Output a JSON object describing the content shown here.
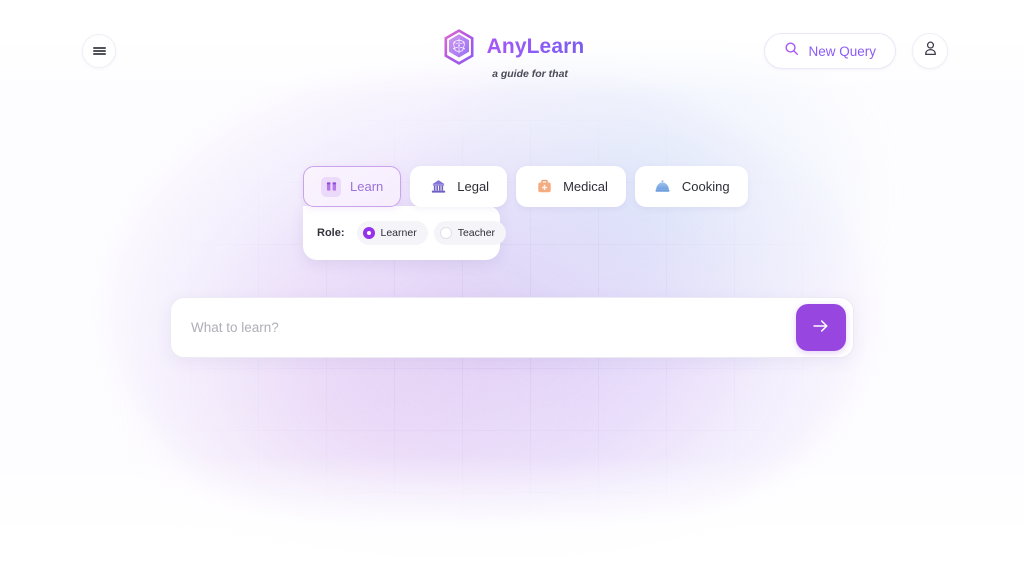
{
  "header": {
    "menu_icon": "hamburger-menu-icon",
    "brand": {
      "name": "AnyLearn",
      "tagline": "a guide for that",
      "logo_icon": "hexagon-brain-logo-icon"
    },
    "new_query": {
      "label": "New Query",
      "icon": "search-icon"
    },
    "account": {
      "icon": "user-avatar-icon"
    }
  },
  "tabs": [
    {
      "label": "Learn",
      "icon": "graduation-books-icon",
      "active": true,
      "icon_class": "ico-learn"
    },
    {
      "label": "Legal",
      "icon": "courthouse-icon",
      "active": false,
      "icon_class": "ico-legal"
    },
    {
      "label": "Medical",
      "icon": "first-aid-kit-icon",
      "active": false,
      "icon_class": "ico-medical"
    },
    {
      "label": "Cooking",
      "icon": "food-cloche-icon",
      "active": false,
      "icon_class": "ico-cooking"
    }
  ],
  "role": {
    "label": "Role:",
    "options": [
      {
        "label": "Learner",
        "selected": true
      },
      {
        "label": "Teacher",
        "selected": false
      }
    ]
  },
  "search": {
    "placeholder": "What to learn?",
    "value": "",
    "submit_icon": "arrow-right-icon"
  },
  "colors": {
    "accent_purple": "#9747e0",
    "brand_purple": "#8b5cf6",
    "active_tab_border": "#cba2ec",
    "radio_selected": "#9333ea",
    "medical_orange": "#f0a274",
    "cooking_blue": "#7aa8e0",
    "legal_indigo": "#6f5fc4"
  }
}
